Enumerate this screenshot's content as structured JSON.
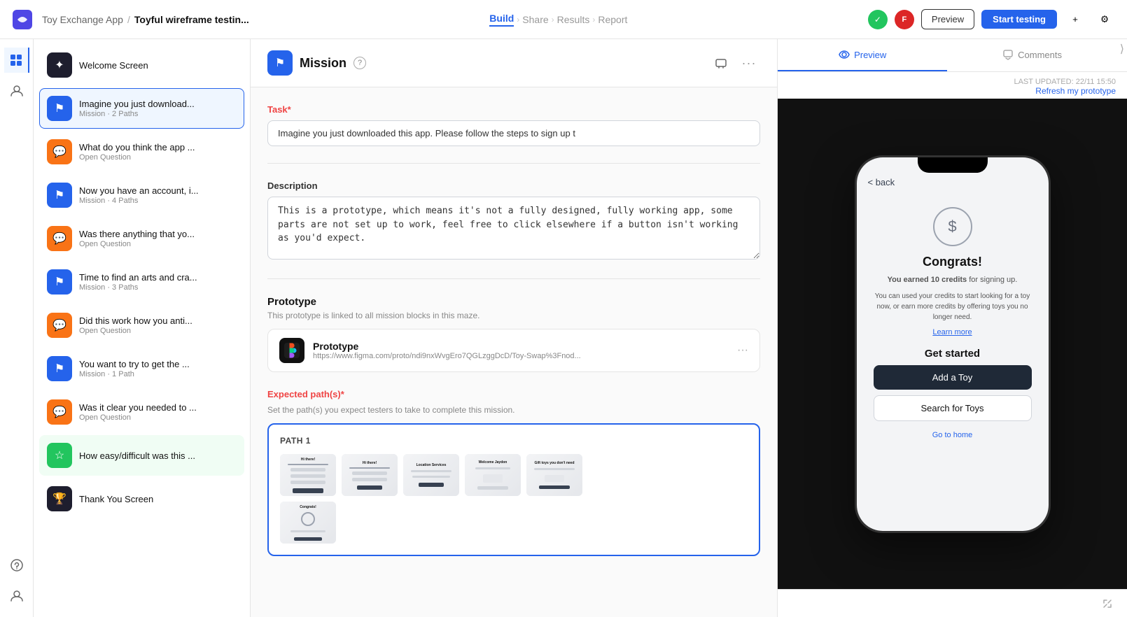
{
  "app": {
    "logo_text": "~",
    "project_name": "Toy Exchange App",
    "separator": "/",
    "page_name": "Toyful wireframe testin..."
  },
  "topnav": {
    "build_label": "Build",
    "share_label": "Share",
    "results_label": "Results",
    "report_label": "Report",
    "preview_label": "Preview",
    "start_testing_label": "Start testing",
    "status_check": "✓",
    "avatar_text": "F",
    "plus_icon": "+",
    "gear_icon": "⚙"
  },
  "iconbar": {
    "items": [
      {
        "name": "grid-icon",
        "icon": "⊞",
        "active": true
      },
      {
        "name": "users-icon",
        "icon": "👤",
        "active": false
      },
      {
        "name": "help-icon",
        "icon": "?",
        "active": false
      },
      {
        "name": "user-icon",
        "icon": "👤",
        "active": false
      }
    ]
  },
  "sidebar": {
    "items": [
      {
        "id": "welcome",
        "type": "dark",
        "icon": "✦",
        "title": "Welcome Screen",
        "sub": "",
        "active": false
      },
      {
        "id": "mission1",
        "type": "blue",
        "icon": "⚑",
        "title": "Imagine you just download...",
        "sub": "Mission · 2 Paths",
        "active": true
      },
      {
        "id": "openq1",
        "type": "orange",
        "icon": "💬",
        "title": "What do you think the app ...",
        "sub": "Open Question",
        "active": false
      },
      {
        "id": "mission2",
        "type": "blue",
        "icon": "⚑",
        "title": "Now you have an account, i...",
        "sub": "Mission · 4 Paths",
        "active": false
      },
      {
        "id": "openq2",
        "type": "orange",
        "icon": "💬",
        "title": "Was there anything that yo...",
        "sub": "Open Question",
        "active": false
      },
      {
        "id": "mission3",
        "type": "blue",
        "icon": "⚑",
        "title": "Time to find an arts and cra...",
        "sub": "Mission · 3 Paths",
        "active": false
      },
      {
        "id": "openq3",
        "type": "orange",
        "icon": "💬",
        "title": "Did this work how you anti...",
        "sub": "Open Question",
        "active": false
      },
      {
        "id": "mission4",
        "type": "blue",
        "icon": "⚑",
        "title": "You want to try to get the ...",
        "sub": "Mission · 1 Path",
        "active": false
      },
      {
        "id": "openq4",
        "type": "orange",
        "icon": "💬",
        "title": "Was it clear you needed to ...",
        "sub": "Open Question",
        "active": false
      },
      {
        "id": "openq5",
        "type": "green",
        "icon": "🏆",
        "title": "How easy/difficult was this ...",
        "sub": "",
        "active": false
      },
      {
        "id": "thankyou",
        "type": "dark",
        "icon": "🏆",
        "title": "Thank You Screen",
        "sub": "",
        "active": false
      }
    ]
  },
  "content": {
    "header": {
      "icon": "⚑",
      "title": "Mission",
      "help_icon": "?",
      "screen_icon": "⊡",
      "more_icon": "···"
    },
    "task": {
      "label": "Task",
      "required": "*",
      "value": "Imagine you just downloaded this app. Please follow the steps to sign up t"
    },
    "description": {
      "label": "Description",
      "value": "This is a prototype, which means it's not a fully designed, fully working app, some parts are not set up to work, feel free to click elsewhere if a button isn't working as you'd expect."
    },
    "prototype": {
      "label": "Prototype",
      "sub": "This prototype is linked to all mission blocks in this maze.",
      "card_name": "Prototype",
      "card_url": "https://www.figma.com/proto/ndi9nxWvgEro7QGLzggDcD/Toy-Swap%3Fnod...",
      "more_icon": "···"
    },
    "expected_paths": {
      "label": "Expected path(s)",
      "required": "*",
      "sub": "Set the path(s) you expect testers to take to complete this mission.",
      "path1_label": "PATH 1"
    }
  },
  "preview_panel": {
    "preview_tab": "Preview",
    "comments_tab": "Comments",
    "last_updated_label": "LAST UPDATED:",
    "last_updated_value": "22/11 15:50",
    "refresh_label": "Refresh my prototype",
    "phone": {
      "back_label": "< back",
      "dollar_symbol": "$",
      "congrats_title": "Congrats!",
      "earned_text": "You earned 10 credits",
      "earned_suffix": "for signing up.",
      "desc_text": "You can used your credits to start looking for a toy now, or earn more credits by offering toys you no longer need.",
      "learn_more": "Learn more",
      "get_started": "Get started",
      "add_toy_btn": "Add a Toy",
      "search_toys_btn": "Search for Toys",
      "go_home": "Go to home"
    }
  }
}
